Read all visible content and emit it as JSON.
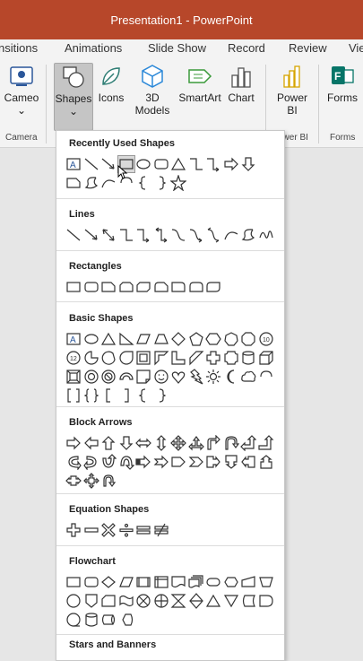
{
  "window": {
    "title": "Presentation1 - PowerPoint",
    "title_bg": "#b7472a"
  },
  "tabs": [
    "nsitions",
    "Animations",
    "Slide Show",
    "Record",
    "Review",
    "View"
  ],
  "ribbon": {
    "cameo": {
      "label": "Cameo",
      "group": "Camera"
    },
    "shapes": {
      "label": "Shapes",
      "selected": true
    },
    "icons": {
      "label": "Icons"
    },
    "models3d": {
      "label1": "3D",
      "label2": "Models"
    },
    "smartart": {
      "label": "SmartArt"
    },
    "chart": {
      "label": "Chart"
    },
    "powerbi": {
      "label1": "Power",
      "label2": "BI",
      "group": "ower BI"
    },
    "forms": {
      "label": "Forms",
      "group": "Forms"
    }
  },
  "shapes_gallery": {
    "sections": [
      {
        "title": "Recently Used Shapes",
        "icons": [
          "text-box",
          "line",
          "line-arrow",
          "rectangle-hover",
          "oval",
          "rounded-rect",
          "triangle",
          "connector-elbow",
          "connector-elbow-arrow",
          "arrow-right",
          "arrow-down",
          "snip-rect",
          "freeform",
          "curve",
          "arc",
          "brace-left",
          "brace-right",
          "star"
        ]
      },
      {
        "title": "Lines",
        "icons": [
          "line",
          "line-arrow",
          "line-double-arrow",
          "connector-elbow",
          "connector-elbow-arrow",
          "connector-elbow-double",
          "connector-curved",
          "connector-curved-arrow",
          "connector-curved-double",
          "curve",
          "freeform",
          "scribble"
        ]
      },
      {
        "title": "Rectangles",
        "icons": [
          "rectangle",
          "rounded-rect",
          "snip-single",
          "snip-same",
          "snip-diagonal",
          "snip-round",
          "round-single",
          "round-same",
          "round-diagonal"
        ]
      },
      {
        "title": "Basic Shapes",
        "icons": [
          "text-box",
          "oval",
          "triangle",
          "right-triangle",
          "parallelogram",
          "trapezoid",
          "diamond",
          "pentagon",
          "hexagon",
          "heptagon",
          "octagon",
          "decagon",
          "dodecagon",
          "pie",
          "chord",
          "teardrop",
          "frame",
          "half-frame",
          "l-shape",
          "diagonal-stripe",
          "cross",
          "plaque",
          "can",
          "cube",
          "bevel",
          "donut",
          "no-symbol",
          "block-arc",
          "folded-corner",
          "smiley",
          "heart",
          "lightning",
          "sun",
          "moon",
          "cloud",
          "arc",
          "bracket-pair",
          "brace-pair",
          "bracket-left",
          "bracket-right",
          "brace-left",
          "brace-right"
        ]
      },
      {
        "title": "Block Arrows",
        "icons": [
          "arrow-right",
          "arrow-left",
          "arrow-up",
          "arrow-down",
          "arrow-left-right",
          "arrow-up-down",
          "arrow-quad",
          "arrow-left-right-up",
          "arrow-bent",
          "arrow-u-turn",
          "arrow-left-up",
          "arrow-bent-up",
          "arrow-curved-right",
          "arrow-curved-left",
          "arrow-curved-up",
          "arrow-curved-down",
          "arrow-striped",
          "arrow-notched",
          "arrow-pentagon",
          "arrow-chevron",
          "callout-right",
          "callout-down",
          "callout-left",
          "callout-up",
          "arrow-callout-left-right",
          "arrow-callout-quad",
          "arrow-circular"
        ]
      },
      {
        "title": "Equation Shapes",
        "icons": [
          "plus",
          "minus",
          "multiply",
          "divide",
          "equal",
          "not-equal"
        ]
      },
      {
        "title": "Flowchart",
        "icons": [
          "process",
          "alt-process",
          "decision",
          "data",
          "predefined",
          "internal-storage",
          "document",
          "multidocument",
          "terminator",
          "preparation",
          "manual-input",
          "manual-operation",
          "connector",
          "offpage",
          "card",
          "punched-tape",
          "summing",
          "or",
          "collate",
          "sort",
          "extract",
          "merge",
          "stored-data",
          "delay",
          "sequential",
          "magnetic-disk",
          "direct-access",
          "display"
        ]
      },
      {
        "title": "Stars and Banners",
        "icons": []
      }
    ]
  }
}
